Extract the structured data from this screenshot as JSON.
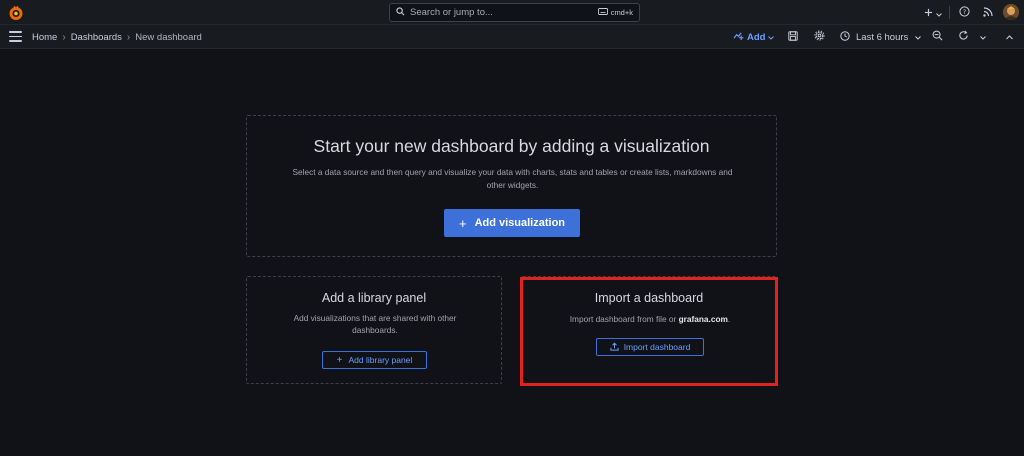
{
  "topbar": {
    "search_placeholder": "Search or jump to...",
    "shortcut": "cmd+k"
  },
  "navbar": {
    "breadcrumbs": [
      "Home",
      "Dashboards",
      "New dashboard"
    ],
    "add_label": "Add",
    "time_range": "Last 6 hours"
  },
  "empty_state": {
    "title": "Start your new dashboard by adding a visualization",
    "description": "Select a data source and then query and visualize your data with charts, stats and tables or create lists, markdowns and other widgets.",
    "add_visualization_label": "Add visualization"
  },
  "library_card": {
    "title": "Add a library panel",
    "description": "Add visualizations that are shared with other dashboards.",
    "button_label": "Add library panel"
  },
  "import_card": {
    "title": "Import a dashboard",
    "description_prefix": "Import dashboard from file or ",
    "description_link": "grafana.com",
    "description_suffix": ".",
    "button_label": "Import dashboard"
  },
  "colors": {
    "background": "#111217",
    "accent": "#3d71d9",
    "highlight": "#e3221d"
  }
}
